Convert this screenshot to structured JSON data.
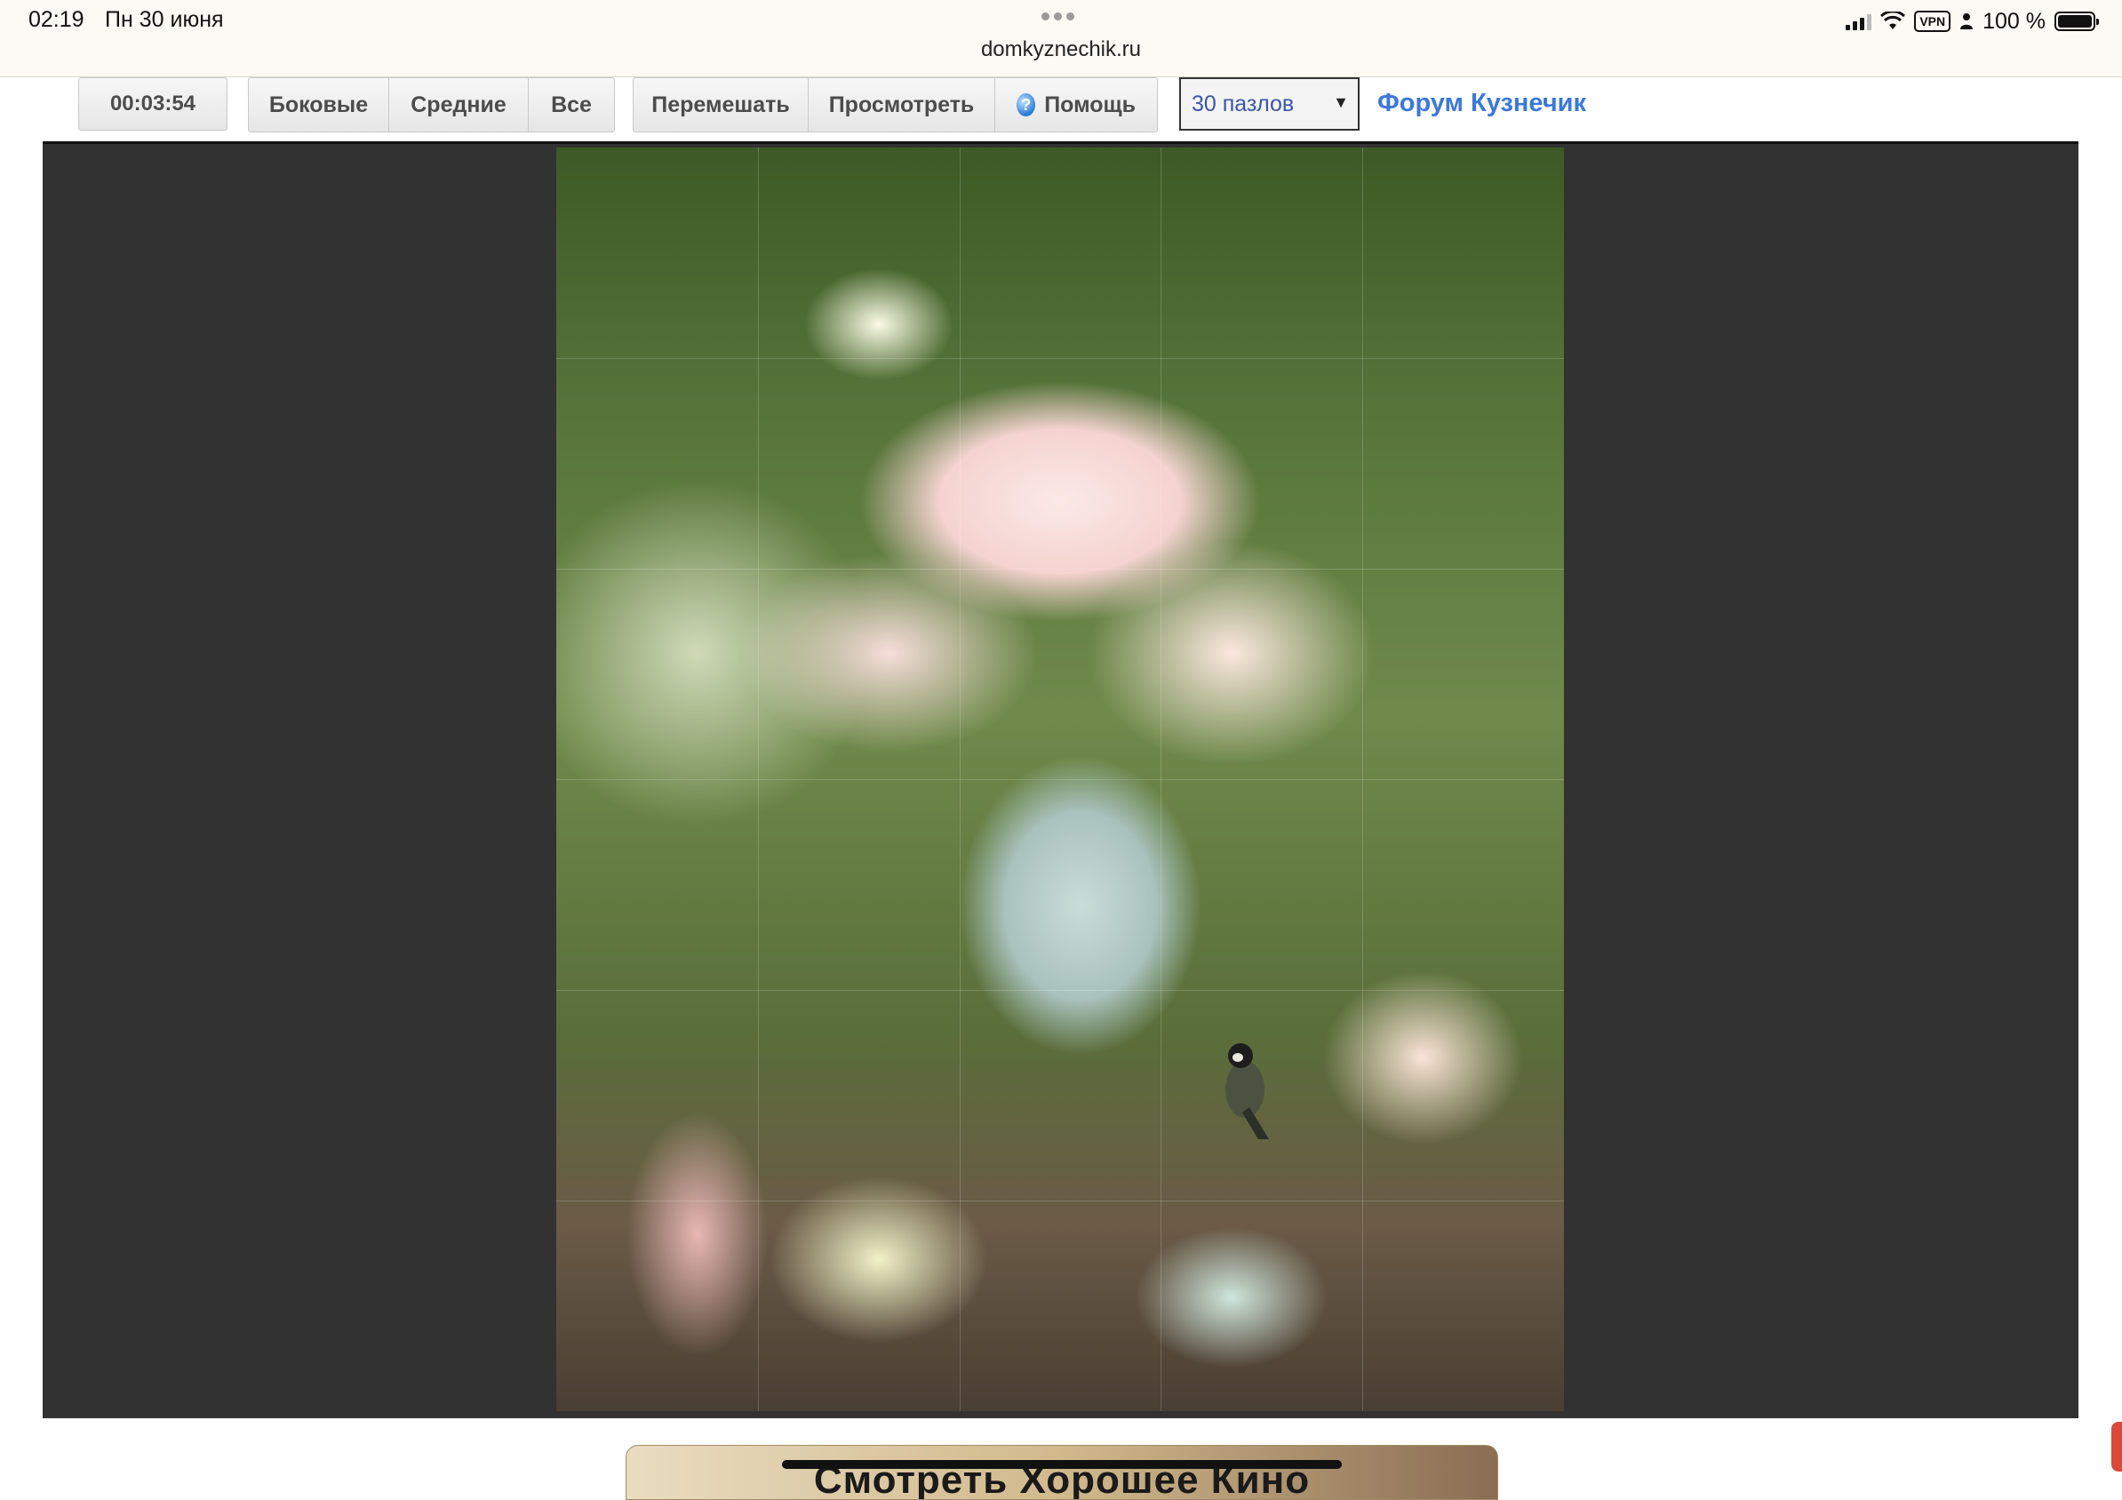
{
  "status_bar": {
    "time": "02:19",
    "date": "Пн 30 июня",
    "url": "domkyznechik.ru",
    "vpn": "VPN",
    "battery": "100 %",
    "battery_level": 1.0
  },
  "toolbar": {
    "timer": "00:03:54",
    "filter_buttons": [
      "Боковые",
      "Средние",
      "Все"
    ],
    "action_buttons": {
      "shuffle": "Перемешать",
      "preview": "Просмотреть",
      "help": "Помощь"
    },
    "puzzle_select": {
      "selected": "30 пазлов"
    },
    "forum_link": "Форум Кузнечик"
  },
  "puzzle": {
    "columns": 5,
    "rows": 6,
    "frame_color": "#323232"
  },
  "banner": {
    "text": "Смотреть Хорошее Кино"
  },
  "colors": {
    "accent_link": "#3b78d8",
    "select_text": "#3a55a8",
    "edge_tab": "#d94a3a"
  }
}
